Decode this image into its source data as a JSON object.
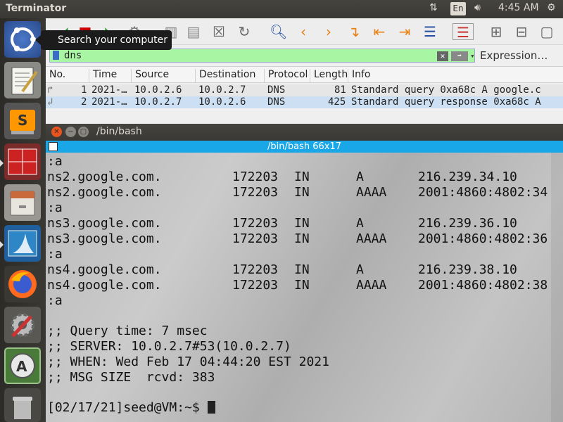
{
  "topbar": {
    "title": "Terminator",
    "lang": "En",
    "clock": "4:45 AM"
  },
  "tooltip": {
    "text": "Search your computer"
  },
  "launcher": {
    "items": [
      "ubuntu-dash",
      "text-editor",
      "sublime-text",
      "terminator",
      "file-manager",
      "wireshark",
      "firefox",
      "system-settings",
      "software-updater",
      "trash"
    ]
  },
  "wireshark": {
    "filter": {
      "value": "dns",
      "expression_label": "Expression…"
    },
    "columns": [
      "No.",
      "Time",
      "Source",
      "Destination",
      "Protocol",
      "Length",
      "Info"
    ],
    "packets": [
      {
        "no": "1",
        "time": "2021-…",
        "source": "10.0.2.6",
        "destination": "10.0.2.7",
        "protocol": "DNS",
        "length": "81",
        "info": "Standard query 0xa68c A google.c"
      },
      {
        "no": "2",
        "time": "2021-…",
        "source": "10.0.2.7",
        "destination": "10.0.2.6",
        "protocol": "DNS",
        "length": "425",
        "info": "Standard query response 0xa68c A"
      }
    ]
  },
  "terminal": {
    "window_title": "/bin/bash",
    "tab_title": "/bin/bash 66x17",
    "records": [
      {
        "prefix": ":a"
      },
      {
        "name": "ns2.google.com.",
        "ttl": "172203",
        "class": "IN",
        "type": "A",
        "data": "216.239.34.10"
      },
      {
        "name": "ns2.google.com.",
        "ttl": "172203",
        "class": "IN",
        "type": "AAAA",
        "data": "2001:4860:4802:34"
      },
      {
        "prefix": ":a"
      },
      {
        "name": "ns3.google.com.",
        "ttl": "172203",
        "class": "IN",
        "type": "A",
        "data": "216.239.36.10"
      },
      {
        "name": "ns3.google.com.",
        "ttl": "172203",
        "class": "IN",
        "type": "AAAA",
        "data": "2001:4860:4802:36"
      },
      {
        "prefix": ":a"
      },
      {
        "name": "ns4.google.com.",
        "ttl": "172203",
        "class": "IN",
        "type": "A",
        "data": "216.239.38.10"
      },
      {
        "name": "ns4.google.com.",
        "ttl": "172203",
        "class": "IN",
        "type": "AAAA",
        "data": "2001:4860:4802:38"
      },
      {
        "prefix": ":a"
      }
    ],
    "footer": [
      ";; Query time: 7 msec",
      ";; SERVER: 10.0.2.7#53(10.0.2.7)",
      ";; WHEN: Wed Feb 17 04:44:20 EST 2021",
      ";; MSG SIZE  rcvd: 383"
    ],
    "prompt": "[02/17/21]seed@VM:~$ "
  }
}
